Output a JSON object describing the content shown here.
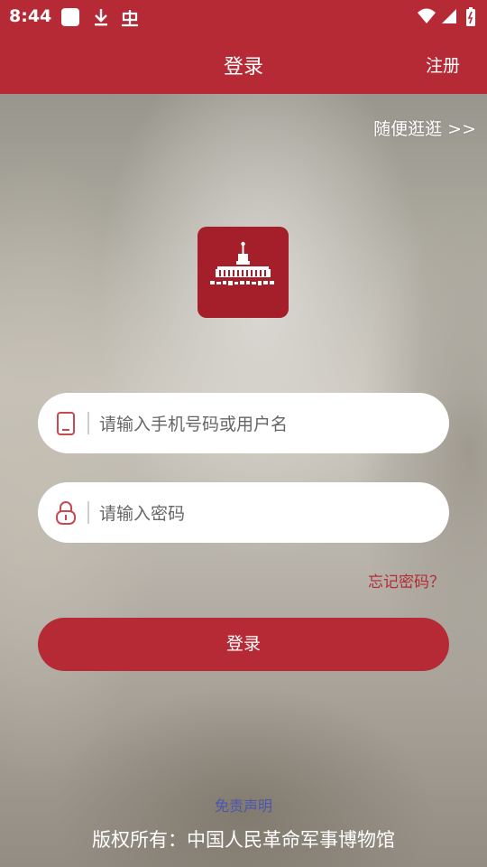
{
  "status_bar": {
    "time": "8:44",
    "left_icons": [
      "square-app-icon",
      "download-icon",
      "bug-icon"
    ],
    "right_icons": [
      "wifi-icon",
      "signal-icon",
      "battery-icon"
    ]
  },
  "header": {
    "title": "登录",
    "register_label": "注册"
  },
  "browse_link": "随便逛逛 >>",
  "logo": {
    "icon": "museum-logo-icon",
    "text": "中国人民革命军事博物馆"
  },
  "form": {
    "username": {
      "placeholder": "请输入手机号码或用户名",
      "value": "",
      "icon": "phone-icon"
    },
    "password": {
      "placeholder": "请输入密码",
      "value": "",
      "icon": "lock-icon"
    },
    "forgot_label": "忘记密码？",
    "login_label": "登录"
  },
  "footer": {
    "disclaimer": "免责声明",
    "copyright": "版权所有：中国人民革命军事博物馆"
  },
  "colors": {
    "brand": "#b52a35",
    "logo_bg": "#a51f2b",
    "disclaimer": "#4a55b0"
  }
}
